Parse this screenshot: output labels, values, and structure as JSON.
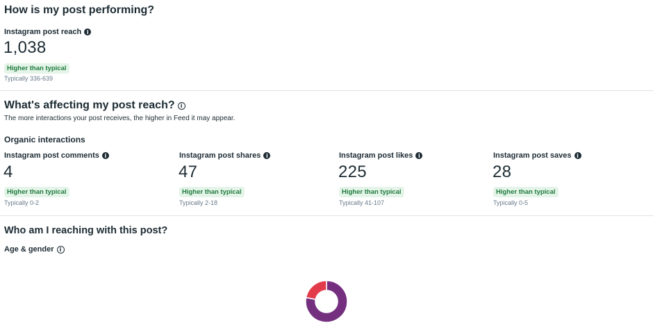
{
  "performance": {
    "title": "How is my post performing?",
    "reach": {
      "label": "Instagram post reach",
      "value": "1,038",
      "badge": "Higher than typical",
      "typical": "Typically 336-639"
    }
  },
  "affecting": {
    "title": "What's affecting my post reach?",
    "description": "The more interactions your post receives, the higher in Feed it may appear.",
    "subtitle": "Organic interactions",
    "metrics": [
      {
        "label": "Instagram post comments",
        "value": "4",
        "badge": "Higher than typical",
        "typical": "Typically 0-2"
      },
      {
        "label": "Instagram post shares",
        "value": "47",
        "badge": "Higher than typical",
        "typical": "Typically 2-18"
      },
      {
        "label": "Instagram post likes",
        "value": "225",
        "badge": "Higher than typical",
        "typical": "Typically 41-107"
      },
      {
        "label": "Instagram post saves",
        "value": "28",
        "badge": "Higher than typical",
        "typical": "Typically 0-5"
      }
    ]
  },
  "audience": {
    "title": "Who am I reaching with this post?",
    "age_gender_label": "Age & gender"
  },
  "chart_data": {
    "type": "pie",
    "colors": [
      "#742f7f",
      "#e23c4a"
    ],
    "slices": [
      {
        "color": "#742f7f",
        "value": 0.78
      },
      {
        "color": "#e23c4a",
        "value": 0.22
      }
    ]
  },
  "colors": {
    "badge_text": "#1f7a3d",
    "badge_bg": "#e4f4e8",
    "divider": "#dde1e4"
  }
}
